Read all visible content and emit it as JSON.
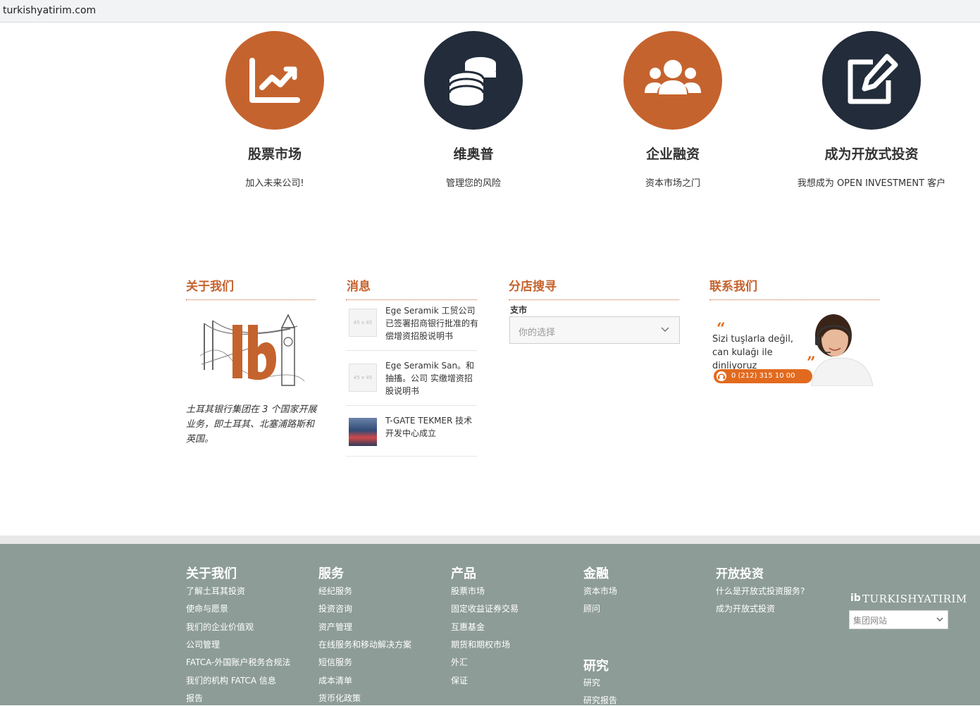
{
  "browser": {
    "url": "turkishyatirim.com"
  },
  "features": [
    {
      "icon": "chart-up-icon",
      "title": "股票市场",
      "subtitle": "加入未来公司!"
    },
    {
      "icon": "coins-icon",
      "title": "维奥普",
      "subtitle": "管理您的风险"
    },
    {
      "icon": "users-icon",
      "title": "企业融资",
      "subtitle": "资本市场之门"
    },
    {
      "icon": "edit-icon",
      "title": "成为开放式投资",
      "subtitle": "我想成为 OPEN INVESTMENT 客户"
    }
  ],
  "about": {
    "title": "关于我们",
    "text": "土耳其银行集团在 3 个国家开展业务，即土耳其、北塞浦路斯和英国。",
    "logo_text": "ib"
  },
  "news": {
    "title": "消息",
    "thumb_placeholder": "45 x 45",
    "items": [
      {
        "text": "Ege Seramik 工贸公司已签署招商银行批准的有偿增资招股说明书"
      },
      {
        "text": "Ege Seramik San。和抽搐。公司 实缴增资招股说明书"
      },
      {
        "text": "T-GATE TEKMER 技术开发中心成立"
      }
    ]
  },
  "branch_search": {
    "title": "分店搜寻",
    "label": "支市",
    "placeholder": "你的选择"
  },
  "contact": {
    "title": "联系我们",
    "quote_line1": "Sizi tuşlarla değil,",
    "quote_line2": "can kulağı ile dinliyoruz",
    "phone": "0 (212) 315 10 00"
  },
  "footer": {
    "columns": [
      {
        "title": "关于我们",
        "links": [
          "了解土耳其投资",
          "使命与愿景",
          "我们的企业价值观",
          "公司管理",
          "FATCA-外国账户税务合规法",
          "我们的机构 FATCA 信息",
          "报告"
        ]
      },
      {
        "title": "服务",
        "links": [
          "经纪服务",
          "投资咨询",
          "资产管理",
          "在线服务和移动解决方案",
          "短信服务",
          "成本清单",
          "货币化政策"
        ]
      },
      {
        "title": "产品",
        "links": [
          "股票市场",
          "固定收益证券交易",
          "互惠基金",
          "期货和期权市场",
          "外汇",
          "保证"
        ]
      },
      {
        "title": "金融",
        "links": [
          "资本市场",
          "顾问"
        ]
      },
      {
        "title": "研究",
        "links": [
          "研究",
          "研究报告"
        ]
      },
      {
        "title": "开放投资",
        "links": [
          "什么是开放式投资服务?",
          "成为开放式投资"
        ]
      }
    ],
    "brand_mark": "ib",
    "brand": "TURKISHYATIRIM",
    "group_select": "集团网站"
  },
  "colors": {
    "accent": "#c5632e",
    "navy": "#222c3a",
    "footer": "#8d9c97"
  }
}
